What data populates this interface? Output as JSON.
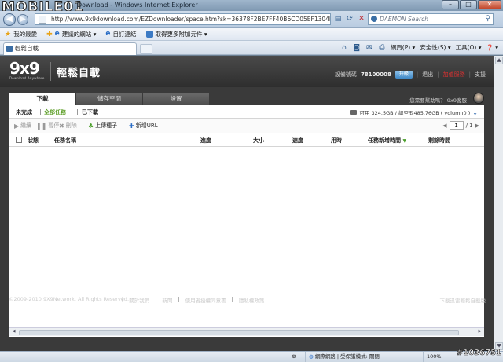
{
  "browser": {
    "watermark_logo": "MOBILE01",
    "title": "Download - Windows Internet Explorer",
    "address_url": "http://www.9x9download.com/EZDownloader/space.htm?sk=36378F2BE7FF40B6CD05EF1304BFDD50WS",
    "search_placeholder": "DAEMON Search",
    "favorites": [
      {
        "label": "我的最愛"
      },
      {
        "label": "建議的網站 ▾"
      },
      {
        "label": "自訂連結"
      },
      {
        "label": "取得更多附加元件 ▾"
      }
    ],
    "tab_label": "輕鬆自載",
    "commands": [
      {
        "label": "網頁(P) ▾"
      },
      {
        "label": "安全性(S) ▾"
      },
      {
        "label": "工具(O) ▾"
      },
      {
        "label": "❓ ▾"
      }
    ]
  },
  "header": {
    "logo_mark": "9x9",
    "logo_tag": "Download Anywhere",
    "app_title": "輕鬆自載",
    "account_label": "設備號碼",
    "account_number": "78100008",
    "vip_button": "升級",
    "logout": "退出",
    "red_link": "加值服務",
    "support": "支援"
  },
  "tabs": [
    {
      "label": "下載",
      "active": true
    },
    {
      "label": "儲存空間",
      "active": false
    },
    {
      "label": "設置",
      "active": false
    }
  ],
  "help_text": "您需要幫助嗎？",
  "help_name": "9x9客服",
  "filters": [
    {
      "label": "未完成"
    },
    {
      "label": "全部任務"
    },
    {
      "label": "已下載"
    }
  ],
  "storage_text": "可用 324.5GB / 總空間485.76GB ( volumn0 )",
  "toolbar": {
    "resume": "繼續",
    "pause": "暫停",
    "delete": "刪除",
    "upload_seed": "上傳種子",
    "add_url": "新增URL"
  },
  "pager": {
    "current": "1",
    "total": "/ 1"
  },
  "columns": [
    {
      "label": "狀態"
    },
    {
      "label": "任務名稱"
    },
    {
      "label": "進度"
    },
    {
      "label": "大小"
    },
    {
      "label": "速度"
    },
    {
      "label": "用時"
    },
    {
      "label": "任務新增時間"
    },
    {
      "label": "剩餘時間"
    }
  ],
  "footer": {
    "copyright": "©2009-2010 9X9Network. All Rights Reserved.",
    "links": [
      {
        "label": "關於我們"
      },
      {
        "label": "新聞"
      },
      {
        "label": "使用者授權同意書"
      },
      {
        "label": "隱私權政策"
      }
    ],
    "right_text": "下載迅雷輕鬆自載版"
  },
  "statusbar": {
    "zone": "網際網路 | 受保護模式: 關閉",
    "zoom": "100%"
  },
  "watermark_id": "#1036751",
  "colors": {
    "accent_green": "#5fa02a",
    "header_dark": "#3a3a3a",
    "link_blue": "#1d5aa6",
    "alert_red": "#e03030"
  }
}
